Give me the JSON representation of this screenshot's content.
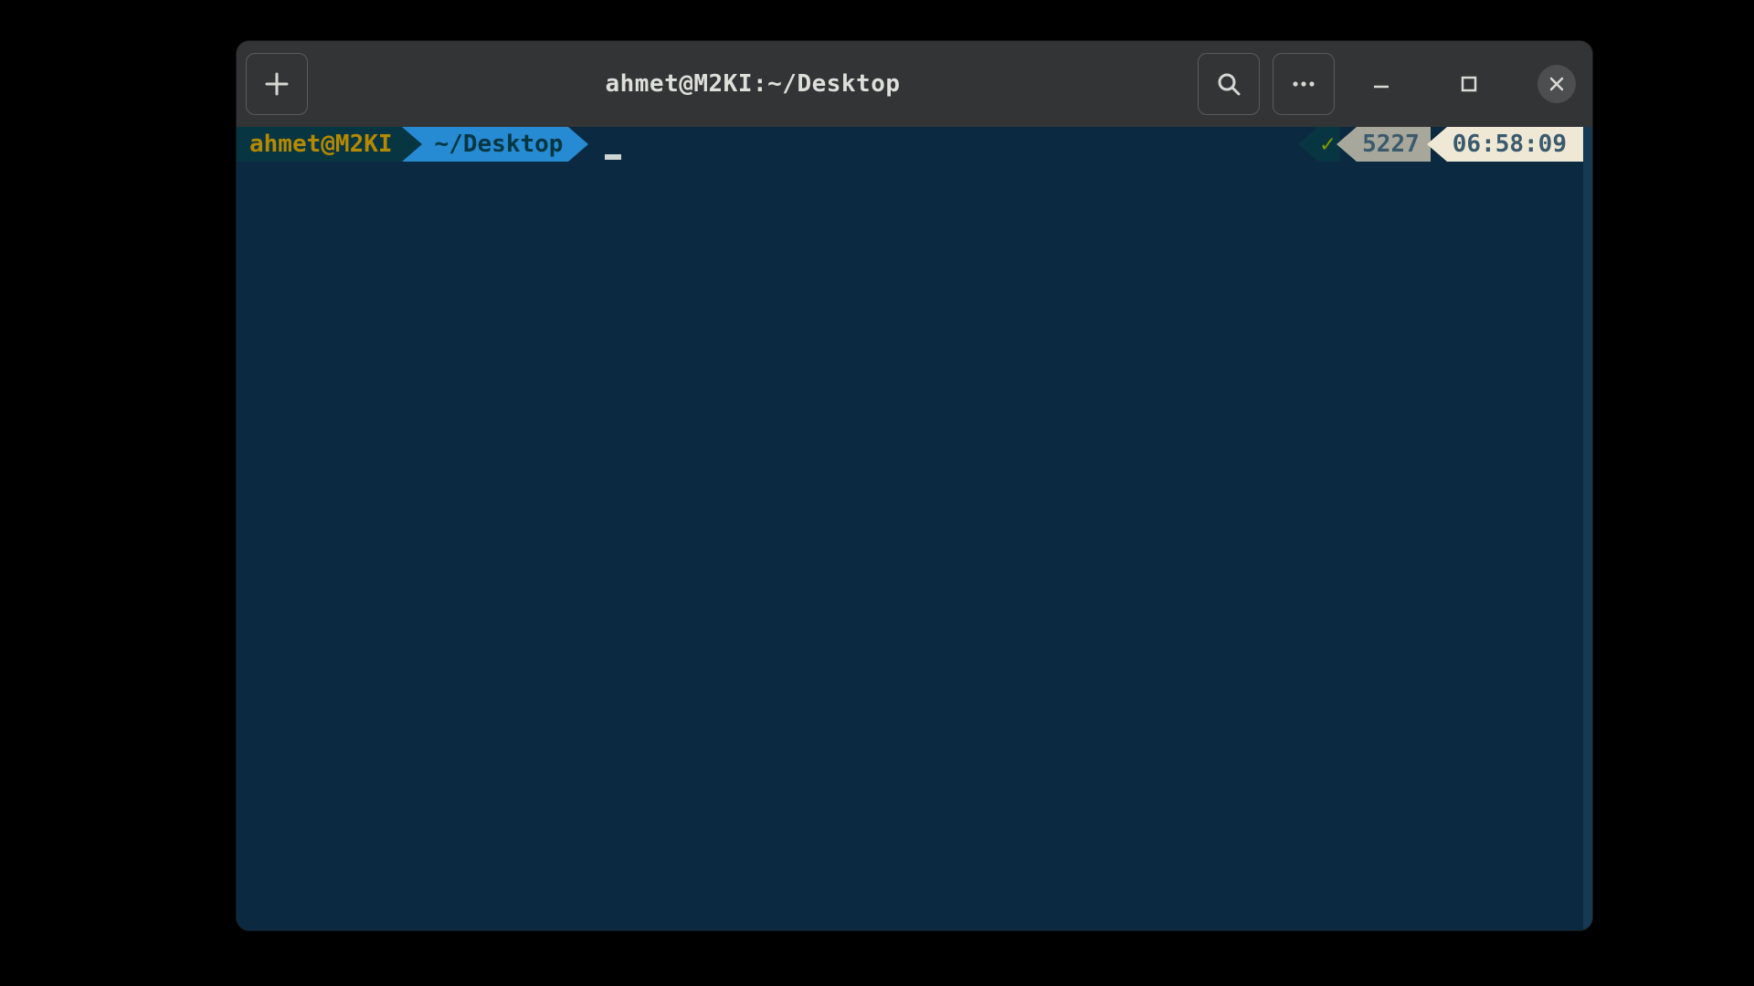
{
  "window": {
    "title": "ahmet@M2KI:~/Desktop"
  },
  "prompt": {
    "user_host": "ahmet@M2KI",
    "path": "~/Desktop"
  },
  "status": {
    "ok_symbol": "✓",
    "history_number": "5227",
    "time": "06:58:09"
  }
}
